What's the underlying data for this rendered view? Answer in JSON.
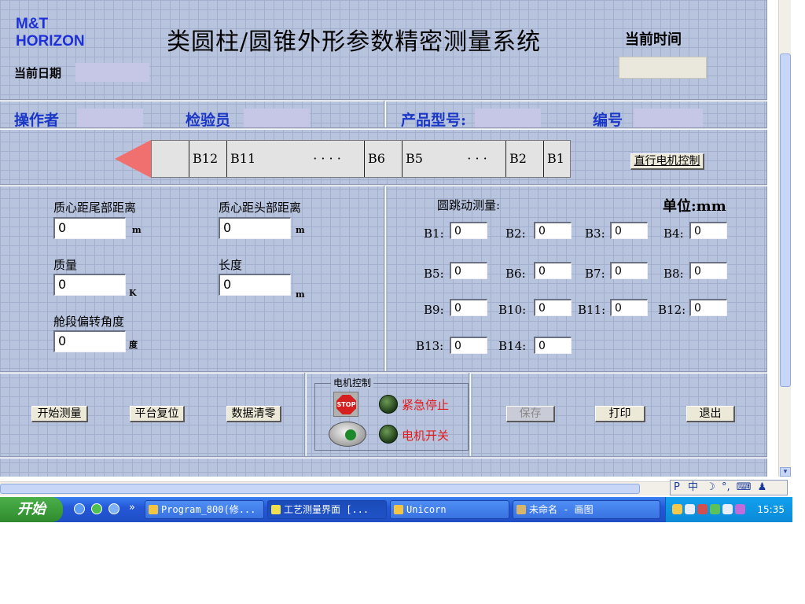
{
  "header": {
    "logo_line1": "M&T",
    "logo_line2": "HORIZON",
    "title": "类圆柱/圆锥外形参数精密测量系统",
    "date_label": "当前日期",
    "time_label": "当前时间"
  },
  "info": {
    "operator_label": "操作者",
    "inspector_label": "检验员",
    "product_model_label": "产品型号:",
    "serial_label": "编号"
  },
  "bar": {
    "cells": [
      "B12",
      "B11",
      "· · · ·",
      "B6",
      "B5",
      "· · ·",
      "B2",
      "B1"
    ],
    "motor_button": "直行电机控制"
  },
  "left_params": {
    "tail_distance_label": "质心距尾部距离",
    "tail_distance_value": "0",
    "tail_distance_unit": "m",
    "head_distance_label": "质心距头部距离",
    "head_distance_value": "0",
    "head_distance_unit": "m",
    "mass_label": "质量",
    "mass_value": "0",
    "mass_unit": "K",
    "length_label": "长度",
    "length_value": "0",
    "length_unit": "m",
    "angle_label": "舱段偏转角度",
    "angle_value": "0",
    "angle_unit": "度"
  },
  "runout": {
    "title": "圆跳动测量:",
    "unit_label": "单位:mm",
    "fields": [
      {
        "label": "B1:",
        "value": "0"
      },
      {
        "label": "B2:",
        "value": "0"
      },
      {
        "label": "B3:",
        "value": "0"
      },
      {
        "label": "B4:",
        "value": "0"
      },
      {
        "label": "B5:",
        "value": "0"
      },
      {
        "label": "B6:",
        "value": "0"
      },
      {
        "label": "B7:",
        "value": "0"
      },
      {
        "label": "B8:",
        "value": "0"
      },
      {
        "label": "B9:",
        "value": "0"
      },
      {
        "label": "B10:",
        "value": "0"
      },
      {
        "label": "B11:",
        "value": "0"
      },
      {
        "label": "B12:",
        "value": "0"
      },
      {
        "label": "B13:",
        "value": "0"
      },
      {
        "label": "B14:",
        "value": "0"
      }
    ]
  },
  "actions": {
    "start_measure": "开始测量",
    "platform_reset": "平台复位",
    "data_clear": "数据清零",
    "save": "保存",
    "print": "打印",
    "exit": "退出"
  },
  "motor_control": {
    "group_title": "电机控制",
    "stop_icon_text": "STOP",
    "emergency_stop_label": "紧急停止",
    "motor_switch_label": "电机开关",
    "label_color": "#e21a1a"
  },
  "ime": {
    "text": "中"
  },
  "taskbar": {
    "start_label": "开始",
    "more_indicator": "»",
    "tasks": [
      {
        "label": "Program_800(修..."
      },
      {
        "label": "工艺测量界面 [..."
      },
      {
        "label": "Unicorn"
      },
      {
        "label": "未命名 - 画图"
      }
    ],
    "clock": "15:35"
  },
  "colors": {
    "panel_bg": "#b8c4de",
    "label_blue": "#1936c7",
    "arrow": "#f07070",
    "taskbar": "#2558d8"
  }
}
